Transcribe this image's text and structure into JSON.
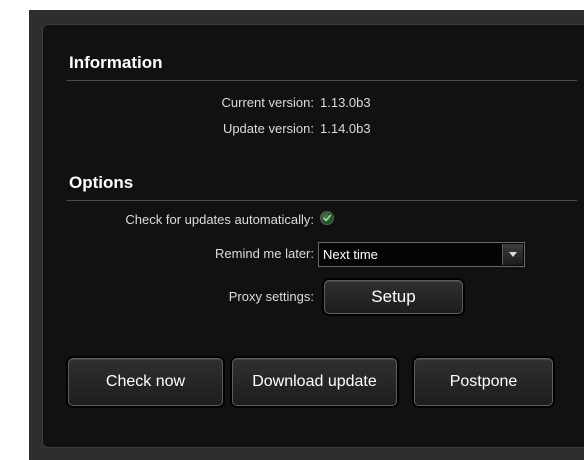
{
  "information": {
    "title": "Information",
    "current_version_label": "Current version:",
    "current_version_value": "1.13.0b3",
    "update_version_label": "Update version:",
    "update_version_value": "1.14.0b3"
  },
  "options": {
    "title": "Options",
    "auto_check_label": "Check for updates automatically:",
    "auto_check_checked": true,
    "remind_label": "Remind me later:",
    "remind_value": "Next time",
    "proxy_label": "Proxy settings:",
    "proxy_button": "Setup"
  },
  "actions": {
    "check_now": "Check now",
    "download_update": "Download update",
    "postpone": "Postpone"
  },
  "colors": {
    "panel_background": "#111111",
    "frame_background": "#2e2e2e",
    "check_accent": "#3f7a3f"
  }
}
